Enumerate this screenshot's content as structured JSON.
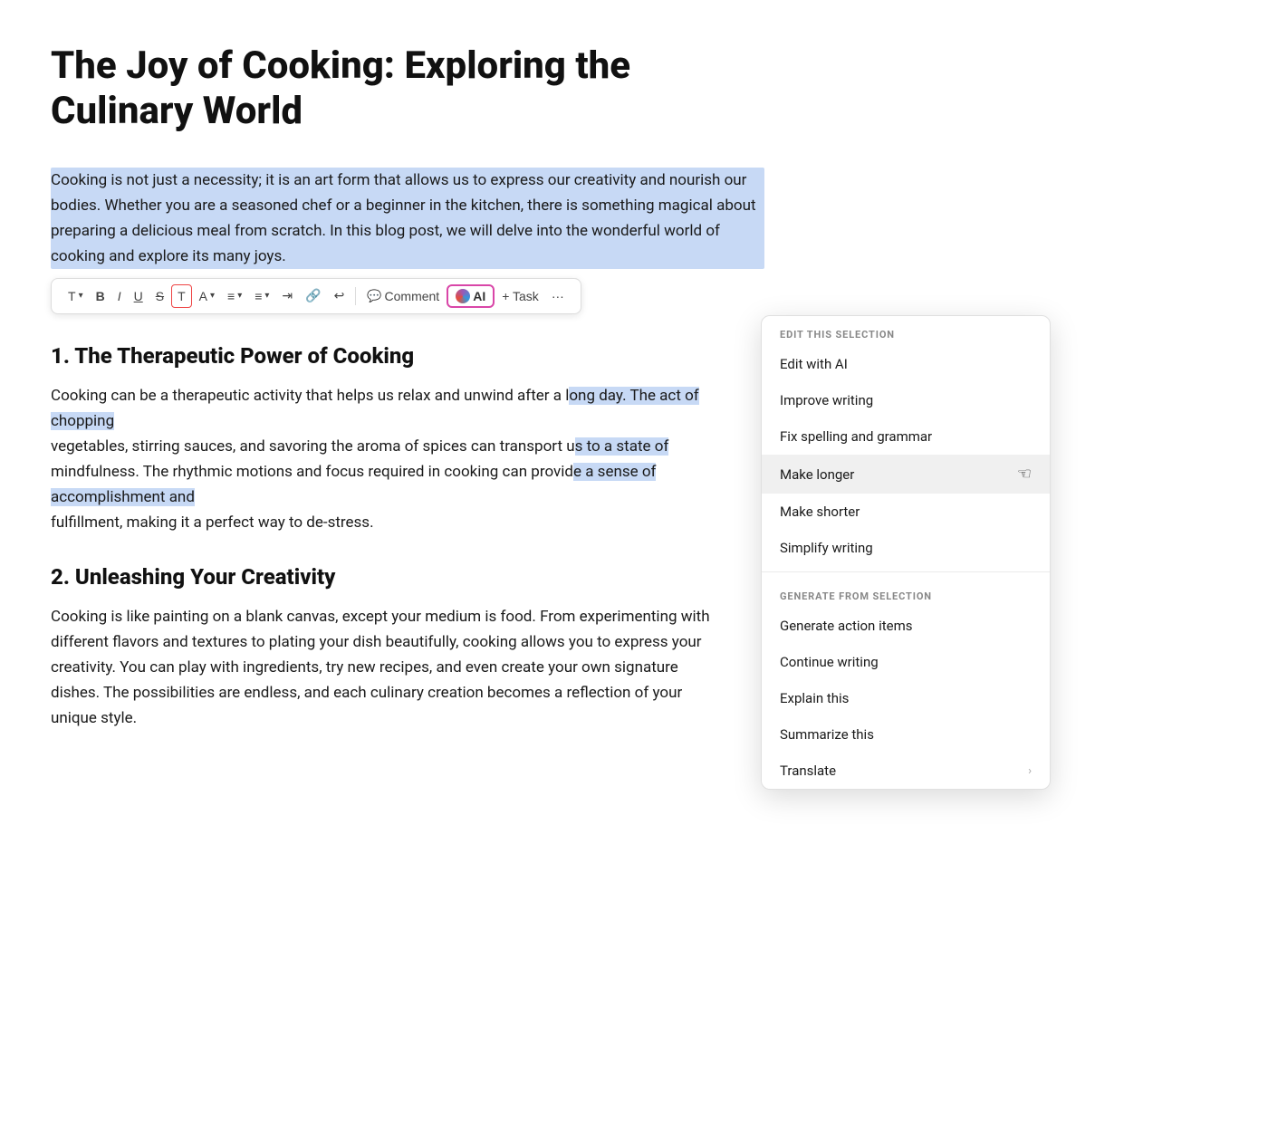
{
  "document": {
    "title": "The Joy of Cooking: Exploring the Culinary World",
    "selected_paragraph": "Cooking is not just a necessity; it is an art form that allows us to express our creativity and nourish our bodies. Whether you are a seasoned chef or a beginner in the kitchen, there is something magical about preparing a delicious meal from scratch. In this blog post, we will delve into the wonderful world of cooking and explore its many joys.",
    "section1": {
      "heading": "1. The Therapeutic Power of Cooking",
      "text": "Cooking can be a therapeutic activity that helps us relax and unwind after a long day. The act of chopping vegetables, stirring sauces, and savoring the aroma of spices can transport us to a state of mindfulness. The rhythmic motions and focus required in cooking can provide a sense of accomplishment and fulfillment, making it a perfect way to de-stress."
    },
    "section2": {
      "heading": "2. Unleashing Your Creativity",
      "text": "Cooking is like painting on a blank canvas, except your medium is food. From experimenting with different flavors and textures to plating your dish beautifully, cooking allows you to express your creativity. You can play with ingredients, try new recipes, and even create your own signature dishes. The possibilities are endless, and each culinary creation becomes a reflection of your unique style."
    }
  },
  "toolbar": {
    "text_style_label": "T",
    "bold_label": "B",
    "italic_label": "I",
    "underline_label": "U",
    "strikethrough_label": "S",
    "highlight_label": "T",
    "font_color_label": "A",
    "align_label": "≡",
    "list_label": "≡",
    "indent_label": "⇥",
    "link_label": "🔗",
    "media_label": "↩",
    "comment_label": "Comment",
    "ai_label": "AI",
    "task_label": "+ Task",
    "more_label": "···"
  },
  "ai_menu": {
    "edit_section_label": "EDIT THIS SELECTION",
    "generate_section_label": "GENERATE FROM SELECTION",
    "edit_items": [
      {
        "label": "Edit with AI",
        "has_arrow": false
      },
      {
        "label": "Improve writing",
        "has_arrow": false
      },
      {
        "label": "Fix spelling and grammar",
        "has_arrow": false
      },
      {
        "label": "Make longer",
        "has_arrow": false,
        "active": true
      },
      {
        "label": "Make shorter",
        "has_arrow": false
      },
      {
        "label": "Simplify writing",
        "has_arrow": false
      }
    ],
    "generate_items": [
      {
        "label": "Generate action items",
        "has_arrow": false
      },
      {
        "label": "Continue writing",
        "has_arrow": false
      },
      {
        "label": "Explain this",
        "has_arrow": false
      },
      {
        "label": "Summarize this",
        "has_arrow": false
      },
      {
        "label": "Translate",
        "has_arrow": true
      }
    ]
  }
}
